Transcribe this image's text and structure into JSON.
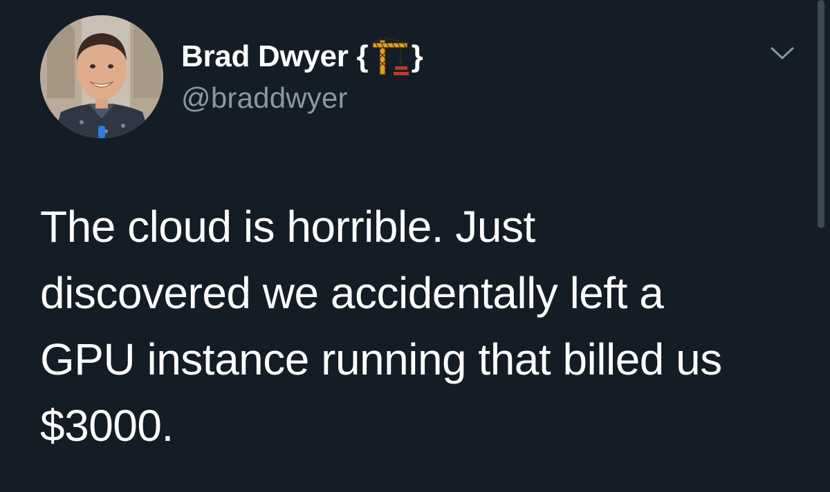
{
  "author": {
    "display_name": "Brad Dwyer",
    "brace_open": "{",
    "brace_close": "}",
    "handle": "@braddwyer"
  },
  "icons": {
    "name_emoji": "construction-crane-icon",
    "menu": "chevron-down-icon"
  },
  "tweet": {
    "lines": [
      "The cloud is horrible. Just",
      "discovered we accidentally left a",
      "GPU instance running that billed us",
      "$3000."
    ]
  },
  "colors": {
    "background": "#141d26",
    "text_primary": "#ffffff",
    "text_secondary": "#8899a6"
  }
}
